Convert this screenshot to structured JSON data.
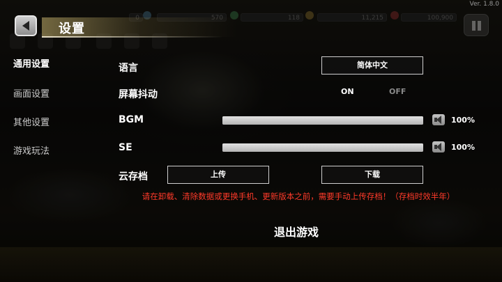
{
  "version": "Ver. 1.8.0",
  "header": {
    "title": "设置",
    "back_icon": "back-arrow-icon",
    "pause_icon": "pause-icon"
  },
  "hud": {
    "values": [
      "0",
      "570",
      "118",
      "11,215",
      "100,900"
    ]
  },
  "sidebar": {
    "items": [
      {
        "label": "通用设置",
        "active": true
      },
      {
        "label": "画面设置",
        "active": false
      },
      {
        "label": "其他设置",
        "active": false
      },
      {
        "label": "游戏玩法",
        "active": false
      }
    ]
  },
  "settings": {
    "language": {
      "label": "语言",
      "value": "简体中文"
    },
    "shake": {
      "label": "屏幕抖动",
      "on": "ON",
      "off": "OFF"
    },
    "bgm": {
      "label": "BGM",
      "volume": "100%",
      "level": 1.0
    },
    "se": {
      "label": "SE",
      "volume": "100%",
      "level": 1.0
    },
    "cloud": {
      "label": "云存档",
      "upload": "上传",
      "download": "下载"
    }
  },
  "warning": "请在卸载、清除数据或更换手机、更新版本之前，需要手动上传存档！（存档时效半年）",
  "exit_label": "退出游戏"
}
